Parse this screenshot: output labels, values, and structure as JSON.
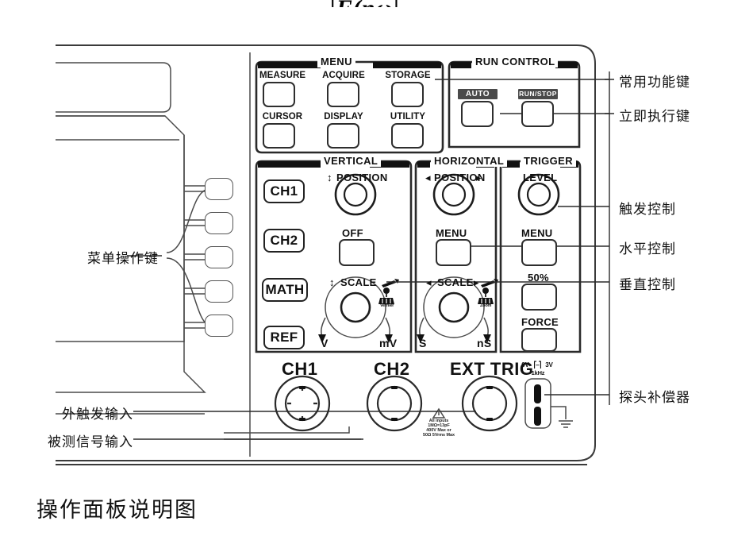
{
  "page": {
    "formula_main": "F(n",
    "formula_omega": "ω",
    "caption": "操作面板说明图"
  },
  "panel": {
    "menu_group": {
      "title": "MENU",
      "buttons": [
        {
          "label": "MEASURE"
        },
        {
          "label": "ACQUIRE"
        },
        {
          "label": "STORAGE"
        },
        {
          "label": "CURSOR"
        },
        {
          "label": "DISPLAY"
        },
        {
          "label": "UTILITY"
        }
      ]
    },
    "run_control_group": {
      "title": "RUN CONTROL",
      "buttons": [
        {
          "label": "AUTO"
        },
        {
          "label": "RUN/STOP"
        }
      ]
    },
    "vertical_group": {
      "title": "VERTICAL",
      "position_label": "POSITION",
      "off_label": "OFF",
      "scale_label": "SCALE",
      "scale_min": "V",
      "scale_max": "mV",
      "vernier_label": "Vernier",
      "channel_keys": [
        {
          "label": "CH1"
        },
        {
          "label": "CH2"
        },
        {
          "label": "MATH"
        },
        {
          "label": "REF"
        }
      ]
    },
    "horizontal_group": {
      "title": "HORIZONTAL",
      "position_label": "POSITION",
      "menu_label": "MENU",
      "scale_label": "SCALE",
      "scale_min": "S",
      "scale_max": "nS",
      "zoom_label": "Zoom"
    },
    "trigger_group": {
      "title": "TRIGGER",
      "level_label": "LEVEL",
      "menu_label": "MENU",
      "fifty_label": "50%",
      "force_label": "FORCE"
    },
    "connectors": {
      "ch1_label": "CH1",
      "ch2_label": "CH2",
      "ext_trig_label": "EXT TRIG",
      "warning_lines": [
        "All inputs",
        "1MΩ=13pF",
        "400V Max or",
        "50Ω 5Vrms Max"
      ],
      "probe_comp_top": "0V",
      "probe_comp_right": "3V",
      "probe_comp_freq": "1kHz"
    },
    "softkey_count": 5
  },
  "annotations": {
    "right": [
      {
        "label": "常用功能键"
      },
      {
        "label": "立即执行键"
      },
      {
        "label": "触发控制"
      },
      {
        "label": "水平控制"
      },
      {
        "label": "垂直控制"
      },
      {
        "label": "探头补偿器"
      }
    ],
    "left": [
      {
        "label": "菜单操作键"
      },
      {
        "label": "外触发输入"
      },
      {
        "label": "被测信号输入"
      }
    ]
  },
  "colors": {
    "outline": "#3a3a3a",
    "ink": "#111111",
    "pill_bg": "#4a4a4a",
    "leader": "#2b2b2b"
  }
}
